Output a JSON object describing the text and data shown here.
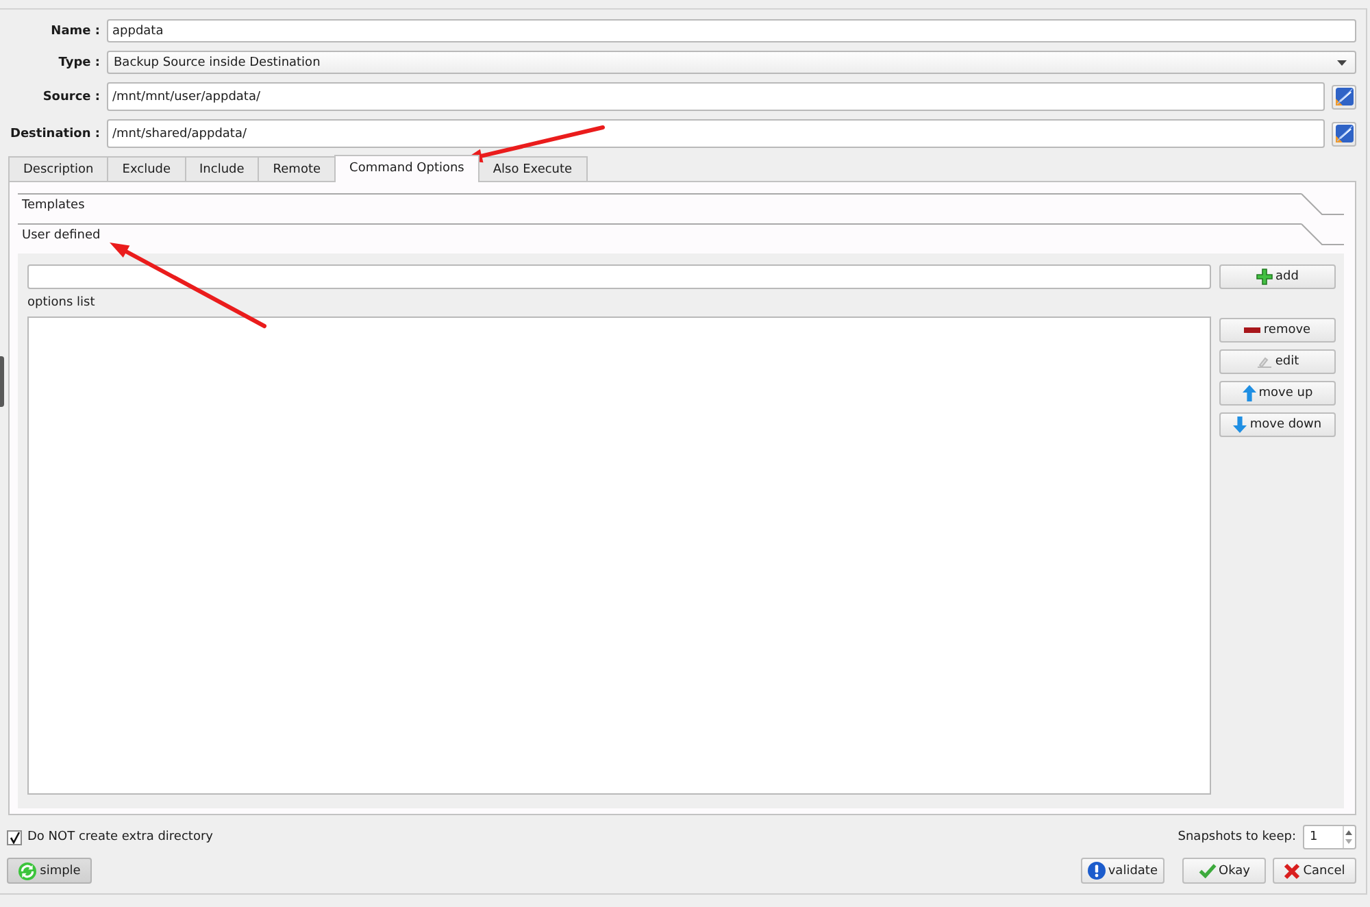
{
  "form": {
    "fields": [
      {
        "label": "Name :",
        "kind": "text",
        "value": "appdata"
      },
      {
        "label": "Type :",
        "kind": "combo",
        "value": "Backup Source inside Destination"
      },
      {
        "label": "Source :",
        "kind": "path",
        "value": "/mnt/mnt/user/appdata/"
      },
      {
        "label": "Destination :",
        "kind": "path",
        "value": "/mnt/shared/appdata/"
      }
    ]
  },
  "tabs": [
    {
      "label": "Description",
      "selected": false
    },
    {
      "label": "Exclude",
      "selected": false
    },
    {
      "label": "Include",
      "selected": false
    },
    {
      "label": "Remote",
      "selected": false
    },
    {
      "label": "Command Options",
      "selected": true
    },
    {
      "label": "Also Execute",
      "selected": false
    }
  ],
  "sections": [
    {
      "title": "Templates"
    },
    {
      "title": "User defined",
      "add_button": {
        "label": "add",
        "kind": "add"
      },
      "list_label": "options list",
      "list_buttons": [
        {
          "label": "remove",
          "kind": "remove"
        },
        {
          "label": "edit",
          "kind": "edit"
        },
        {
          "label": "move up",
          "kind": "up"
        },
        {
          "label": "move down",
          "kind": "down"
        }
      ]
    }
  ],
  "footer": {
    "checkbox": {
      "label": "Do NOT create extra directory",
      "checked": true
    },
    "snapshots": {
      "label": "Snapshots to keep:",
      "value": "1"
    },
    "mode_button": {
      "label": "simple",
      "kind": "simple"
    },
    "buttons": [
      {
        "label": "validate",
        "kind": "validate"
      },
      {
        "label": "Okay",
        "kind": "okay"
      },
      {
        "label": "Cancel",
        "kind": "cancel"
      }
    ]
  }
}
